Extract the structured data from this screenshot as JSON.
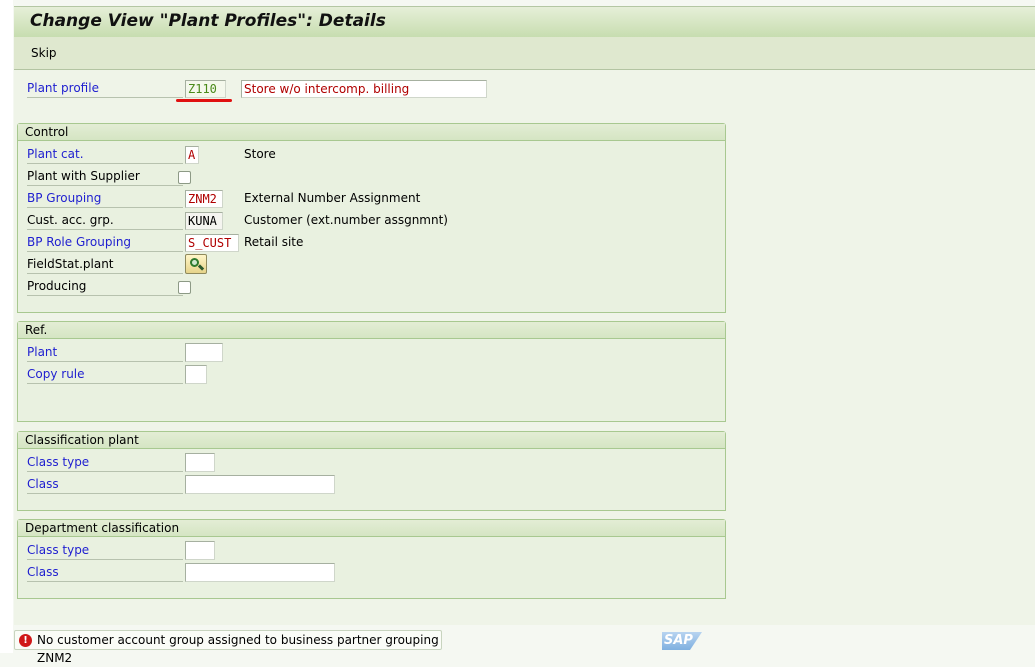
{
  "window": {
    "title": "Change View \"Plant Profiles\": Details"
  },
  "toolbar": {
    "skip_label": "Skip"
  },
  "header_fields": {
    "plant_profile": {
      "label": "Plant profile",
      "value": "Z110",
      "description": "Store w/o intercomp. billing"
    }
  },
  "groups": {
    "control": {
      "title": "Control",
      "plant_cat": {
        "label": "Plant cat.",
        "value": "A",
        "description": "Store"
      },
      "plant_with_supplier": {
        "label": "Plant with Supplier",
        "checked": false
      },
      "bp_grouping": {
        "label": "BP Grouping",
        "value": "ZNM2",
        "description": "External Number Assignment"
      },
      "cust_acc_grp": {
        "label": "Cust. acc. grp.",
        "value": "KUNA",
        "description": "Customer (ext.number assgnmnt)"
      },
      "bp_role_grouping": {
        "label": "BP Role Grouping",
        "value": "S_CUST",
        "description": "Retail site"
      },
      "fieldstat_plant": {
        "label": "FieldStat.plant",
        "icon": "field-status-icon"
      },
      "producing": {
        "label": "Producing",
        "checked": false
      }
    },
    "ref": {
      "title": "Ref.",
      "plant": {
        "label": "Plant",
        "value": ""
      },
      "copy_rule": {
        "label": "Copy rule",
        "value": ""
      }
    },
    "classification_plant": {
      "title": "Classification plant",
      "class_type": {
        "label": "Class type",
        "value": ""
      },
      "class": {
        "label": "Class",
        "value": ""
      }
    },
    "department_classification": {
      "title": "Department classification",
      "class_type": {
        "label": "Class type",
        "value": ""
      },
      "class": {
        "label": "Class",
        "value": ""
      }
    }
  },
  "status": {
    "type": "error",
    "icon": "error-icon",
    "message": "No customer account group assigned to business partner grouping ZNM2"
  },
  "branding": {
    "logo": "SAP"
  }
}
